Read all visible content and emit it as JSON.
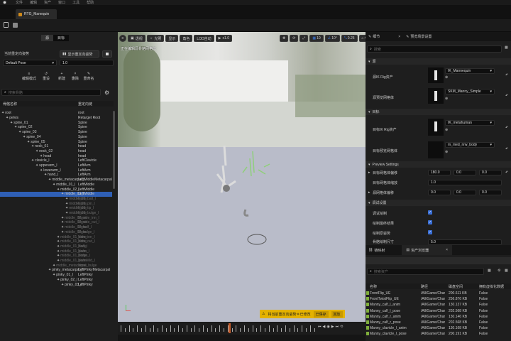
{
  "menu": [
    "文件",
    "编辑",
    "资产",
    "窗口",
    "工具",
    "帮助"
  ],
  "tab_title": "RTG_Manequin",
  "left": {
    "tabs": [
      "源",
      "目标"
    ],
    "current_pose_label": "当前重定向姿势",
    "show_pose_button": "显示重定向姿势",
    "pose_select": "Default Pose",
    "pose_value": "1.0",
    "tools": [
      "编辑模式",
      "重设",
      "新建",
      "删除",
      "重命名"
    ],
    "search_placeholder": "搜索骨骼",
    "columns": [
      "骨骼名称",
      "重定向链"
    ]
  },
  "bones": [
    {
      "name": "root",
      "chain": "root",
      "depth": 0,
      "dim": false
    },
    {
      "name": "pelvis",
      "chain": "Retarget Root",
      "depth": 1,
      "dim": false
    },
    {
      "name": "spine_01",
      "chain": "Spine",
      "depth": 2,
      "dim": false
    },
    {
      "name": "spine_02",
      "chain": "Spine",
      "depth": 3,
      "dim": false
    },
    {
      "name": "spine_03",
      "chain": "Spine",
      "depth": 4,
      "dim": false
    },
    {
      "name": "spine_04",
      "chain": "Spine",
      "depth": 5,
      "dim": false
    },
    {
      "name": "spine_05",
      "chain": "Spine",
      "depth": 6,
      "dim": false
    },
    {
      "name": "neck_01",
      "chain": "head",
      "depth": 7,
      "dim": false
    },
    {
      "name": "neck_02",
      "chain": "head",
      "depth": 8,
      "dim": false
    },
    {
      "name": "head",
      "chain": "head",
      "depth": 9,
      "dim": false
    },
    {
      "name": "clavicle_l",
      "chain": "LeftClavicle",
      "depth": 7,
      "dim": false
    },
    {
      "name": "upperarm_l",
      "chain": "LeftArm",
      "depth": 8,
      "dim": false
    },
    {
      "name": "lowerarm_l",
      "chain": "LeftArm",
      "depth": 9,
      "dim": false
    },
    {
      "name": "hand_l",
      "chain": "LeftArm",
      "depth": 10,
      "dim": false
    },
    {
      "name": "middle_metacarpal_l",
      "chain": "LeftMiddleMetacarpal",
      "depth": 11,
      "dim": false
    },
    {
      "name": "middle_01_l",
      "chain": "LeftMiddle",
      "depth": 12,
      "dim": false
    },
    {
      "name": "middle_02_l",
      "chain": "LeftMiddle",
      "depth": 13,
      "dim": false
    },
    {
      "name": "middle_03_l",
      "chain": "LeftMiddle",
      "depth": 14,
      "dim": false
    },
    {
      "name": "middle_03_ball_l",
      "chain": "None",
      "depth": 15,
      "dim": true
    },
    {
      "name": "middle_03_pin_l",
      "chain": "None",
      "depth": 15,
      "dim": true
    },
    {
      "name": "middle_03_tip_l",
      "chain": "None",
      "depth": 15,
      "dim": true
    },
    {
      "name": "middle_03_bulge_l",
      "chain": "None",
      "depth": 15,
      "dim": true
    },
    {
      "name": "middle_02_side_inn_l",
      "chain": "None",
      "depth": 14,
      "dim": true
    },
    {
      "name": "middle_02_side_out_l",
      "chain": "None",
      "depth": 14,
      "dim": true
    },
    {
      "name": "middle_02_half_l",
      "chain": "None",
      "depth": 14,
      "dim": true
    },
    {
      "name": "middle_02_bulge_l",
      "chain": "None",
      "depth": 14,
      "dim": true
    },
    {
      "name": "middle_01_side_inn_l",
      "chain": "None",
      "depth": 13,
      "dim": true
    },
    {
      "name": "middle_01_side_out_l",
      "chain": "None",
      "depth": 13,
      "dim": true
    },
    {
      "name": "middle_01_half_l",
      "chain": "None",
      "depth": 13,
      "dim": true
    },
    {
      "name": "middle_01_palm_l",
      "chain": "None",
      "depth": 13,
      "dim": true
    },
    {
      "name": "middle_01_bulge_l",
      "chain": "None",
      "depth": 13,
      "dim": true
    },
    {
      "name": "middle_01_palmMid_l",
      "chain": "None",
      "depth": 13,
      "dim": true
    },
    {
      "name": "middle_metacarpal_bulge",
      "chain": "None",
      "depth": 12,
      "dim": true
    },
    {
      "name": "pinky_metacarpal_l",
      "chain": "LeftPinkyMetacarpal",
      "depth": 11,
      "dim": false
    },
    {
      "name": "pinky_01_l",
      "chain": "LeftPinky",
      "depth": 12,
      "dim": false
    },
    {
      "name": "pinky_02_l",
      "chain": "LeftPinky",
      "depth": 13,
      "dim": false
    },
    {
      "name": "pinky_03_l",
      "chain": "LeftPinky",
      "depth": 14,
      "dim": false
    }
  ],
  "viewport": {
    "buttons": [
      "透视",
      "光照",
      "显示",
      "角色",
      "LOD自动",
      "x1.0"
    ],
    "snap_values": [
      "10",
      "10°",
      "0.25",
      "4"
    ],
    "overlay_text": "正在编辑源骨骼网格体",
    "notice": "将当前重定向姿势＊已修改",
    "notice_buttons": [
      "已保存",
      "回放"
    ]
  },
  "details": {
    "tabs": [
      "细节",
      "预览场景设置"
    ],
    "search_placeholder": "搜索",
    "sections": {
      "source": "源",
      "target": "目标",
      "preview": "Preview Settings",
      "debug": "调试设置"
    },
    "source_ik_label": "源IK Rig资产",
    "source_ik_value": "IK_Mannequin",
    "source_mesh_label": "源预览网格体",
    "source_mesh_value": "SKM_Manny_Simple",
    "target_ik_label": "目标IK Rig资产",
    "target_ik_value": "IK_metahuman",
    "target_mesh_label": "目标预览网格体",
    "target_mesh_value": "m_med_nrw_body",
    "offset_label": "目标网格体偏移",
    "offset_values": [
      "180.0",
      "0.0",
      "0.0"
    ],
    "scale_label": "目标网格体缩放",
    "scale_value": "1.0",
    "source_offset_label": "源网格体偏移",
    "source_offset_values": [
      "0.0",
      "0.0",
      "0.0"
    ],
    "debug_rows": [
      "调试绘制",
      "绘制最终结果",
      "绘制原姿势",
      "骨骼绘制尺寸"
    ],
    "bone_size_value": "5.0"
  },
  "bottom": {
    "tabs": [
      "链映射",
      "资产浏览器"
    ],
    "search_placeholder": "搜索资产",
    "columns": [
      "名称",
      "路径",
      "磁盘空间",
      "拥有虚拟化数据"
    ],
    "assets": [
      {
        "name": "FrontFlip_UE",
        "path": "/All/Game/Char",
        "size": "200.611 KB",
        "virtual": "False"
      },
      {
        "name": "FrontTwistFlip_UE",
        "path": "/All/Game/Char",
        "size": "256.876 KB",
        "virtual": "False"
      },
      {
        "name": "Manny_calf_l_anim",
        "path": "/All/Game/Char",
        "size": "130.137 KB",
        "virtual": "False"
      },
      {
        "name": "Manny_calf_l_pose",
        "path": "/All/Game/Char",
        "size": "202.568 KB",
        "virtual": "False"
      },
      {
        "name": "Manny_calf_r_anim",
        "path": "/All/Game/Char",
        "size": "130.146 KB",
        "virtual": "False"
      },
      {
        "name": "Manny_calf_r_pose",
        "path": "/All/Game/Char",
        "size": "202.568 KB",
        "virtual": "False"
      },
      {
        "name": "Manny_clavicle_l_anim",
        "path": "/All/Game/Char",
        "size": "130.168 KB",
        "virtual": "False"
      },
      {
        "name": "Manny_clavicle_l_pose",
        "path": "/All/Game/Char",
        "size": "200.191 KB",
        "virtual": "False"
      }
    ]
  },
  "colors": {
    "accent": "#e4b200",
    "highlight": "#2f5fb5",
    "check": "#3a6fd6"
  }
}
